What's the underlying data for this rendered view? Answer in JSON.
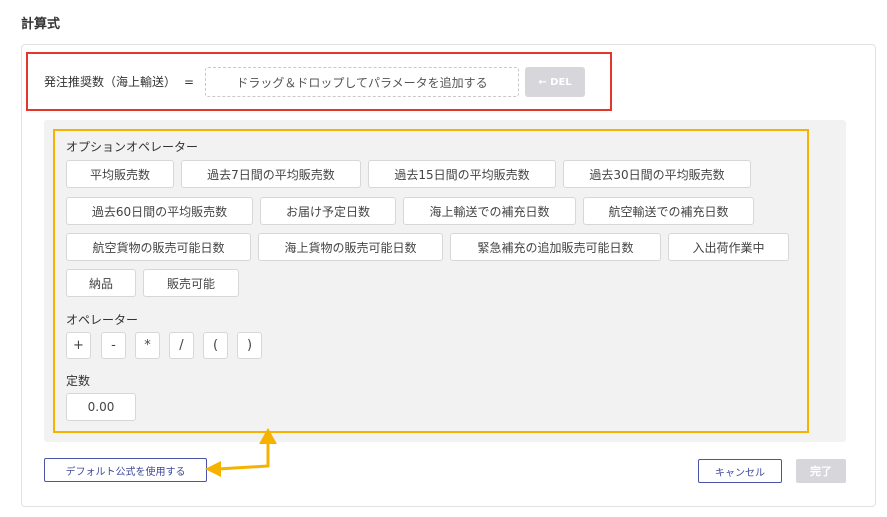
{
  "section_title": "計算式",
  "formula": {
    "label": "発注推奨数（海上輸送）",
    "equals": "=",
    "drop_placeholder": "ドラッグ＆ドロップしてパラメータを追加する",
    "del_label": "← DEL"
  },
  "option_operators": {
    "label": "オプションオペレーター",
    "items": [
      "平均販売数",
      "過去7日間の平均販売数",
      "過去15日間の平均販売数",
      "過去30日間の平均販売数",
      "過去60日間の平均販売数",
      "お届け予定日数",
      "海上輸送での補充日数",
      "航空輸送での補充日数",
      "航空貨物の販売可能日数",
      "海上貨物の販売可能日数",
      "緊急補充の追加販売可能日数",
      "入出荷作業中",
      "納品",
      "販売可能"
    ]
  },
  "operators": {
    "label": "オペレーター",
    "items": [
      "+",
      "-",
      "*",
      "/",
      "(",
      ")"
    ]
  },
  "constant": {
    "label": "定数",
    "value": "0.00"
  },
  "footer": {
    "default_formula_label": "デフォルト公式を使用する",
    "cancel_label": "キャンセル",
    "done_label": "完了"
  },
  "colors": {
    "highlight_red": "#e2372a",
    "highlight_yellow": "#f5b300",
    "primary": "#3f4a9c",
    "disabled": "#d6d6db"
  }
}
